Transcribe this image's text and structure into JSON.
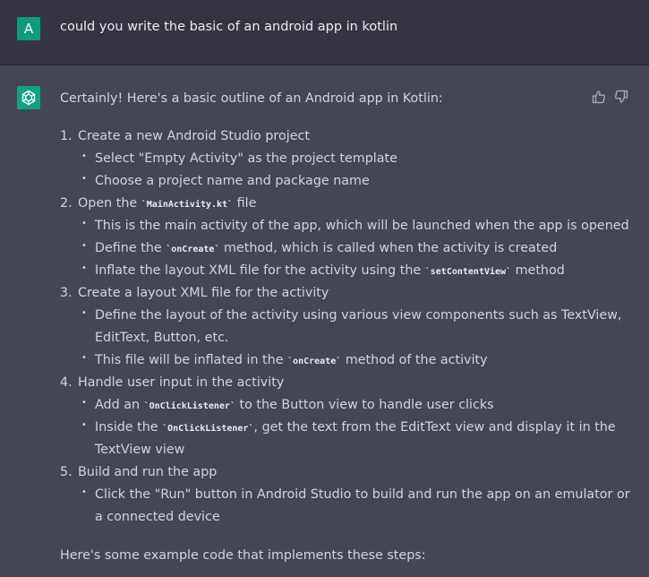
{
  "user": {
    "avatar_letter": "A",
    "message": "could you write the basic of an android app in kotlin"
  },
  "assistant": {
    "intro": "Certainly! Here's a basic outline of an Android app in Kotlin:",
    "steps": [
      {
        "num": "1.",
        "text": "Create a new Android Studio project",
        "bullets": [
          "Select \"Empty Activity\" as the project template",
          "Choose a project name and package name"
        ]
      },
      {
        "num": "2.",
        "text_a": "Open the ",
        "code": "`MainActivity.kt`",
        "text_b": " file",
        "b1": "This is the main activity of the app, which will be launched when the app is opened",
        "b2_a": "Define the ",
        "b2_code": "`onCreate`",
        "b2_b": " method, which is called when the activity is created",
        "b3_a": "Inflate the layout XML file for the activity using the ",
        "b3_code": "`setContentView`",
        "b3_b": " method"
      },
      {
        "num": "3.",
        "text": "Create a layout XML file for the activity",
        "b1_l1": "Define the layout of the activity using various view components such as TextView,",
        "b1_l2": "EditText, Button, etc.",
        "b2_a": "This file will be inflated in the ",
        "b2_code": "`onCreate`",
        "b2_b": " method of the activity"
      },
      {
        "num": "4.",
        "text": "Handle user input in the activity",
        "b1_a": "Add an ",
        "b1_code": "`OnClickListener`",
        "b1_b": " to the Button view to handle user clicks",
        "b2_a": "Inside the ",
        "b2_code": "`OnClickListener`",
        "b2_b": ", get the text from the EditText view and display it in the",
        "b2_l2": "TextView view"
      },
      {
        "num": "5.",
        "text": "Build and run the app",
        "b1_l1": "Click the \"Run\" button in Android Studio to build and run the app on an emulator or",
        "b1_l2": "a connected device"
      }
    ],
    "outro": "Here's some example code that implements these steps:",
    "bullet_glyph": "•"
  },
  "colors": {
    "user_bg": "#343541",
    "assistant_bg": "#444654",
    "avatar_user": "#0e9b7c",
    "avatar_bot": "#10a37f",
    "text": "#d1d5db"
  },
  "icons": [
    "openai-logo-icon",
    "thumbs-up-icon",
    "thumbs-down-icon"
  ]
}
